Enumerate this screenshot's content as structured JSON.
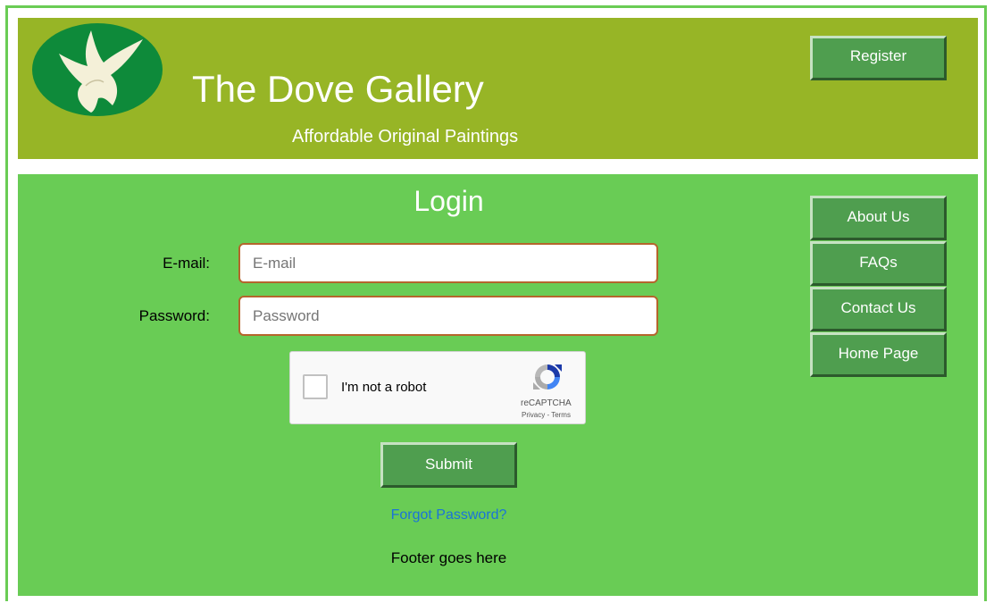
{
  "header": {
    "title": "The Dove Gallery",
    "subtitle": "Affordable Original Paintings",
    "register_label": "Register",
    "logo_icon": "dove-logo-icon"
  },
  "login": {
    "title": "Login",
    "email_label": "E-mail:",
    "email_placeholder": "E-mail",
    "email_value": "",
    "password_label": "Password:",
    "password_placeholder": "Password",
    "password_value": "",
    "submit_label": "Submit",
    "forgot_label": "Forgot Password?"
  },
  "captcha": {
    "label": "I'm not a robot",
    "brand": "reCAPTCHA",
    "links": "Privacy - Terms",
    "icon": "recaptcha-icon"
  },
  "nav": {
    "items": [
      {
        "label": "About Us"
      },
      {
        "label": "FAQs"
      },
      {
        "label": "Contact Us"
      },
      {
        "label": "Home Page"
      }
    ]
  },
  "footer": {
    "text": "Footer goes here"
  },
  "colors": {
    "header_bg": "#97b526",
    "main_bg": "#69cc55",
    "button_bg": "#4f9e4f",
    "logo_bg": "#0e8a3a",
    "link": "#1a73d9"
  }
}
